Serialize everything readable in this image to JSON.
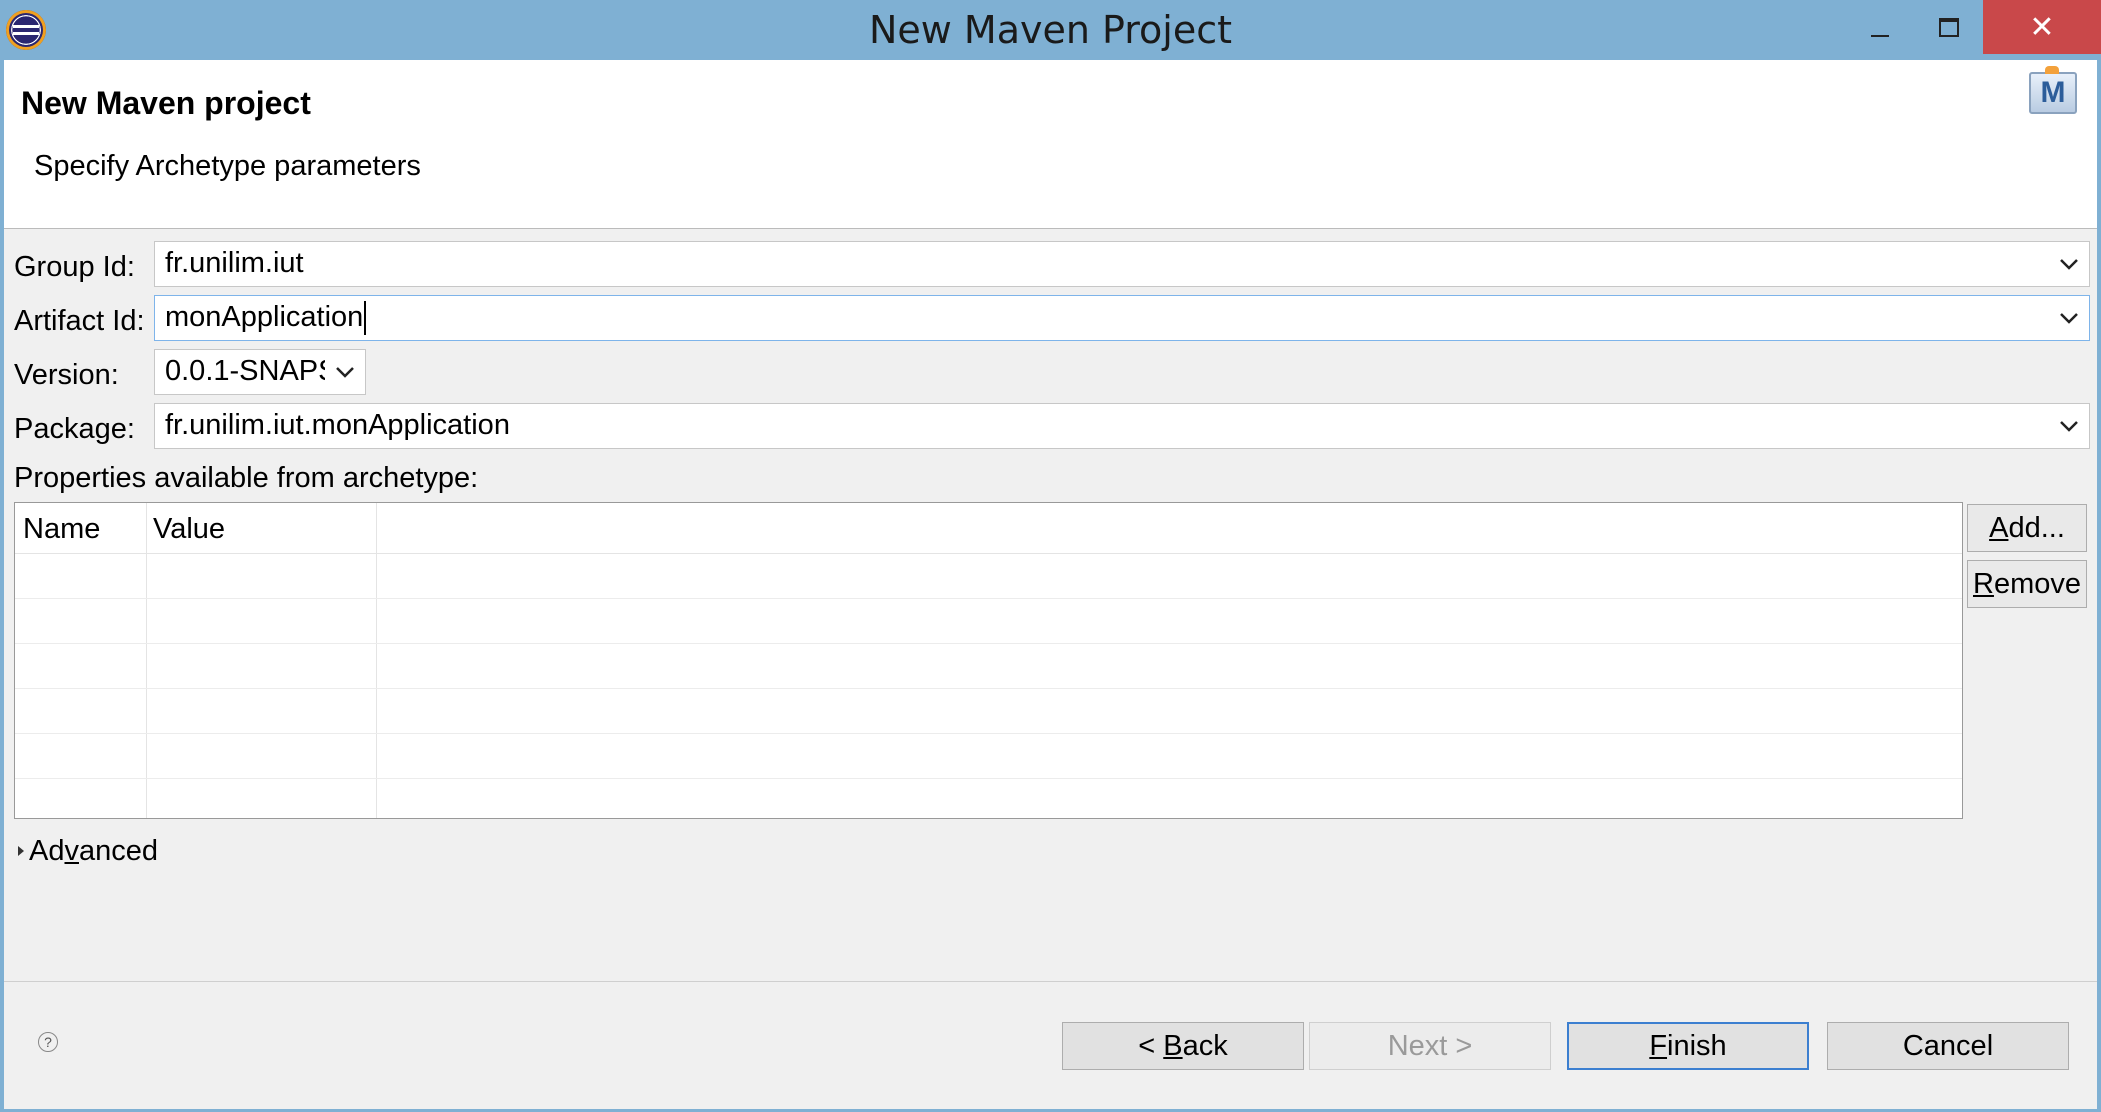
{
  "window": {
    "title": "New Maven Project",
    "close_glyph": "✕"
  },
  "header": {
    "title": "New Maven project",
    "subtitle": "Specify Archetype parameters",
    "icon_letter": "M"
  },
  "form": {
    "group_id_label": "Group Id:",
    "group_id_value": "fr.unilim.iut",
    "artifact_id_label": "Artifact Id:",
    "artifact_id_value": "monApplication",
    "version_label": "Version:",
    "version_value": "0.0.1-SNAPS",
    "package_label": "Package:",
    "package_value": "fr.unilim.iut.monApplication",
    "properties_label": "Properties available from archetype:"
  },
  "table": {
    "columns": [
      "Name",
      "Value"
    ],
    "rows": []
  },
  "side_buttons": {
    "add_mnemonic": "A",
    "add_rest": "dd...",
    "remove_mnemonic": "R",
    "remove_rest": "emove"
  },
  "advanced": {
    "pre": "Ad",
    "mnemonic": "v",
    "post": "anced"
  },
  "footer": {
    "help_glyph": "?",
    "back_pre": "< ",
    "back_mnemonic": "B",
    "back_rest": "ack",
    "next_label": "Next >",
    "finish_mnemonic": "F",
    "finish_rest": "inish",
    "cancel_label": "Cancel"
  },
  "colors": {
    "titlebar": "#7fb0d3",
    "close_button": "#c9484a",
    "focus_border": "#7eb4ea",
    "default_button_border": "#3c7fd0"
  }
}
